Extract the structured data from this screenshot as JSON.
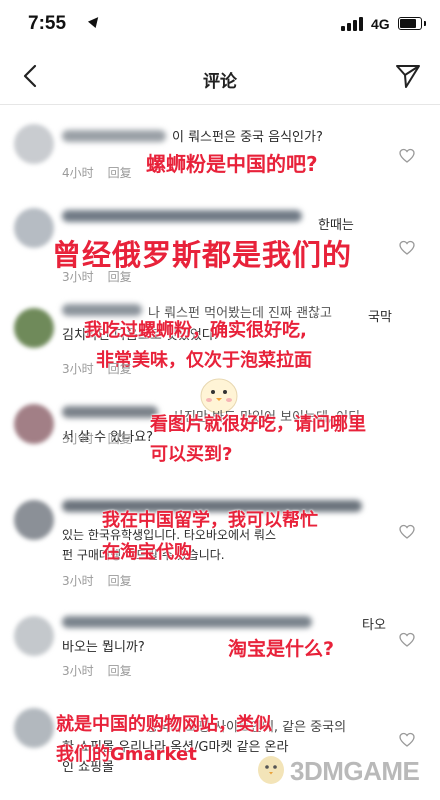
{
  "status_bar": {
    "time": "7:55",
    "network": "4G"
  },
  "header": {
    "title": "评论"
  },
  "comments": [
    {
      "korean": "이 뤄스펀은 중국 음식인가?",
      "time": "4小时",
      "reply": "回复",
      "overlay": [
        "螺蛳粉是中国的吧?"
      ]
    },
    {
      "korean": "한때는",
      "time": "3小时",
      "reply": "回复",
      "overlay": [
        "曾经俄罗斯都是我们的"
      ]
    },
    {
      "korean_lines": [
        "나 뤄스펀 먹어봤는데 진짜 괜찮고",
        "김치라면 다음으로 맛있었다."
      ],
      "korean_tail": "국막",
      "time": "3小时",
      "reply": "回复",
      "overlay": [
        "我吃过螺蛳粉，确实很好吃,",
        "非常美味，仅次于泡菜拉面"
      ]
    },
    {
      "korean_lines": [
        "사진만 봐도 맛있어 보이는데, 어디",
        "서 살 수 있나요?"
      ],
      "time": "3小时",
      "reply": "回复",
      "overlay": [
        "看图片就很好吃，请问哪里",
        "可以买到?"
      ]
    },
    {
      "korean_lines": [
        "있는 한국유학생입니다. 타오바오에서 뤄스",
        "펀 구매대행 해드릴 수 있습니다."
      ],
      "time": "3小时",
      "reply": "回复",
      "overlay": [
        "我在中国留学，我可以帮忙",
        "在淘宝代购"
      ]
    },
    {
      "korean_lines": [
        "타오",
        "바오는 뭡니까?"
      ],
      "time": "3小时",
      "reply": "回复",
      "overlay": [
        "淘宝是什么?"
      ]
    },
    {
      "korean_lines": [
        "중국의 쇼핑 사이트인데, 같은 중국의",
        "한 쇼핑몰 우리나라 옥션/G마켓 같은 온라",
        "인 쇼핑몰"
      ],
      "overlay": [
        "就是中国的购物网站，类似",
        "我们的Gmarket"
      ]
    }
  ],
  "watermark": {
    "text": "3DMGAME"
  },
  "colors": {
    "overlay": "#e8223a",
    "meta": "#9a9a9a"
  }
}
